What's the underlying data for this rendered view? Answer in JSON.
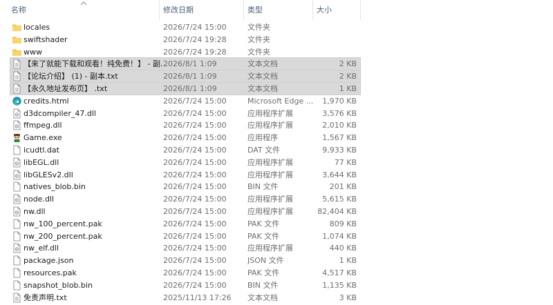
{
  "header": {
    "name": "名称",
    "date": "修改日期",
    "type": "类型",
    "size": "大小"
  },
  "rows": [
    {
      "name": "locales",
      "date": "2026/7/24 15:00",
      "type": "文件夹",
      "size": "",
      "icon": "folder-icon",
      "selected": false
    },
    {
      "name": "swiftshader",
      "date": "2026/7/24 19:28",
      "type": "文件夹",
      "size": "",
      "icon": "folder-icon",
      "selected": false
    },
    {
      "name": "www",
      "date": "2026/7/24 19:28",
      "type": "文件夹",
      "size": "",
      "icon": "folder-icon",
      "selected": false
    },
    {
      "name": "【来了就能下载和观看！纯免费！】 - 副...",
      "date": "2026/8/1 1:09",
      "type": "文本文档",
      "size": "2 KB",
      "icon": "text-file-icon",
      "selected": true
    },
    {
      "name": "【论坛介绍】 (1) - 副本.txt",
      "date": "2026/8/1 1:09",
      "type": "文本文档",
      "size": "2 KB",
      "icon": "text-file-icon",
      "selected": true
    },
    {
      "name": "【永久地址发布页】 .txt",
      "date": "2026/8/1 1:09",
      "type": "文本文档",
      "size": "1 KB",
      "icon": "text-file-icon",
      "selected": true
    },
    {
      "name": "credits.html",
      "date": "2026/7/24 15:00",
      "type": "Microsoft Edge ...",
      "size": "1,970 KB",
      "icon": "edge-html-icon",
      "selected": false
    },
    {
      "name": "d3dcompiler_47.dll",
      "date": "2026/7/24 15:00",
      "type": "应用程序扩展",
      "size": "3,576 KB",
      "icon": "dll-file-icon",
      "selected": false
    },
    {
      "name": "ffmpeg.dll",
      "date": "2026/7/24 15:00",
      "type": "应用程序扩展",
      "size": "2,010 KB",
      "icon": "dll-file-icon",
      "selected": false
    },
    {
      "name": "Game.exe",
      "date": "2026/7/24 15:00",
      "type": "应用程序",
      "size": "1,567 KB",
      "icon": "game-exe-icon",
      "selected": false
    },
    {
      "name": "icudtl.dat",
      "date": "2026/7/24 15:00",
      "type": "DAT 文件",
      "size": "9,933 KB",
      "icon": "blank-file-icon",
      "selected": false
    },
    {
      "name": "libEGL.dll",
      "date": "2026/7/24 15:00",
      "type": "应用程序扩展",
      "size": "77 KB",
      "icon": "dll-file-icon",
      "selected": false
    },
    {
      "name": "libGLESv2.dll",
      "date": "2026/7/24 15:00",
      "type": "应用程序扩展",
      "size": "3,644 KB",
      "icon": "dll-file-icon",
      "selected": false
    },
    {
      "name": "natives_blob.bin",
      "date": "2026/7/24 15:00",
      "type": "BIN 文件",
      "size": "201 KB",
      "icon": "blank-file-icon",
      "selected": false
    },
    {
      "name": "node.dll",
      "date": "2026/7/24 15:00",
      "type": "应用程序扩展",
      "size": "5,615 KB",
      "icon": "dll-file-icon",
      "selected": false
    },
    {
      "name": "nw.dll",
      "date": "2026/7/24 15:00",
      "type": "应用程序扩展",
      "size": "82,404 KB",
      "icon": "dll-file-icon",
      "selected": false
    },
    {
      "name": "nw_100_percent.pak",
      "date": "2026/7/24 15:00",
      "type": "PAK 文件",
      "size": "809 KB",
      "icon": "blank-file-icon",
      "selected": false
    },
    {
      "name": "nw_200_percent.pak",
      "date": "2026/7/24 15:00",
      "type": "PAK 文件",
      "size": "1,074 KB",
      "icon": "blank-file-icon",
      "selected": false
    },
    {
      "name": "nw_elf.dll",
      "date": "2026/7/24 15:00",
      "type": "应用程序扩展",
      "size": "440 KB",
      "icon": "dll-file-icon",
      "selected": false
    },
    {
      "name": "package.json",
      "date": "2026/7/24 15:00",
      "type": "JSON 文件",
      "size": "1 KB",
      "icon": "blank-file-icon",
      "selected": false
    },
    {
      "name": "resources.pak",
      "date": "2026/7/24 15:00",
      "type": "PAK 文件",
      "size": "4,517 KB",
      "icon": "blank-file-icon",
      "selected": false
    },
    {
      "name": "snapshot_blob.bin",
      "date": "2026/7/24 15:00",
      "type": "BIN 文件",
      "size": "1,135 KB",
      "icon": "blank-file-icon",
      "selected": false
    },
    {
      "name": "免责声明.txt",
      "date": "2025/11/13 17:26",
      "type": "文本文档",
      "size": "3 KB",
      "icon": "text-file-icon",
      "selected": false
    }
  ],
  "colors": {
    "folder": "#f4c542",
    "selection": "#d9d9d9",
    "header_text": "#4c607a",
    "secondary_text": "#6d6d6d"
  }
}
